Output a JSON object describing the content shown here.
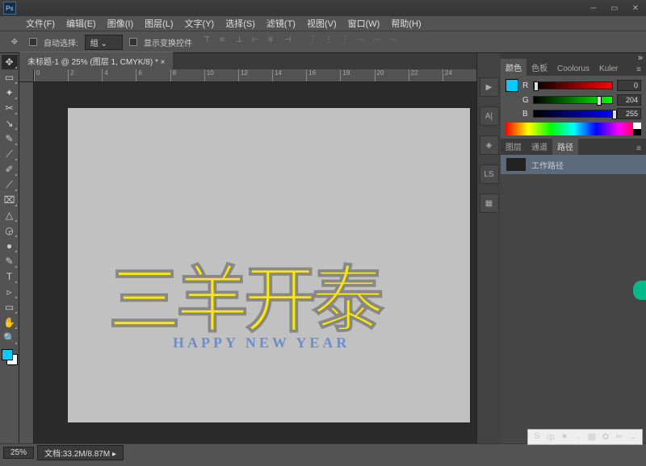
{
  "menubar": [
    "文件(F)",
    "编辑(E)",
    "图像(I)",
    "图层(L)",
    "文字(Y)",
    "选择(S)",
    "滤镜(T)",
    "视图(V)",
    "窗口(W)",
    "帮助(H)"
  ],
  "options": {
    "auto_select_label": "自动选择:",
    "auto_select_mode": "组",
    "show_transform_label": "显示变换控件"
  },
  "document": {
    "tab_label": "未标题-1 @ 25% (图层 1, CMYK/8) *",
    "canvas_main_text": "三羊开泰",
    "canvas_sub_text": "HAPPY NEW YEAR"
  },
  "ruler_marks": [
    "0",
    "2",
    "4",
    "6",
    "8",
    "10",
    "12",
    "14",
    "16",
    "18",
    "20",
    "22",
    "24"
  ],
  "color_panel": {
    "tabs": [
      "颜色",
      "色板",
      "Coolorus",
      "Kuler"
    ],
    "channels": [
      {
        "label": "R",
        "value": "0",
        "pos": 0,
        "cls": "r"
      },
      {
        "label": "G",
        "value": "204",
        "pos": 80,
        "cls": "g"
      },
      {
        "label": "B",
        "value": "255",
        "pos": 100,
        "cls": "b"
      }
    ]
  },
  "paths_panel": {
    "tabs": [
      "图层",
      "通道",
      "路径"
    ],
    "active_tab": "路径",
    "item_label": "工作路径"
  },
  "status": {
    "zoom": "25%",
    "doc_info": "文档:33.2M/8.87M"
  },
  "tray_icons": [
    "S",
    "中",
    "●",
    ",",
    "▦",
    "✿",
    "✂",
    "⌄"
  ]
}
